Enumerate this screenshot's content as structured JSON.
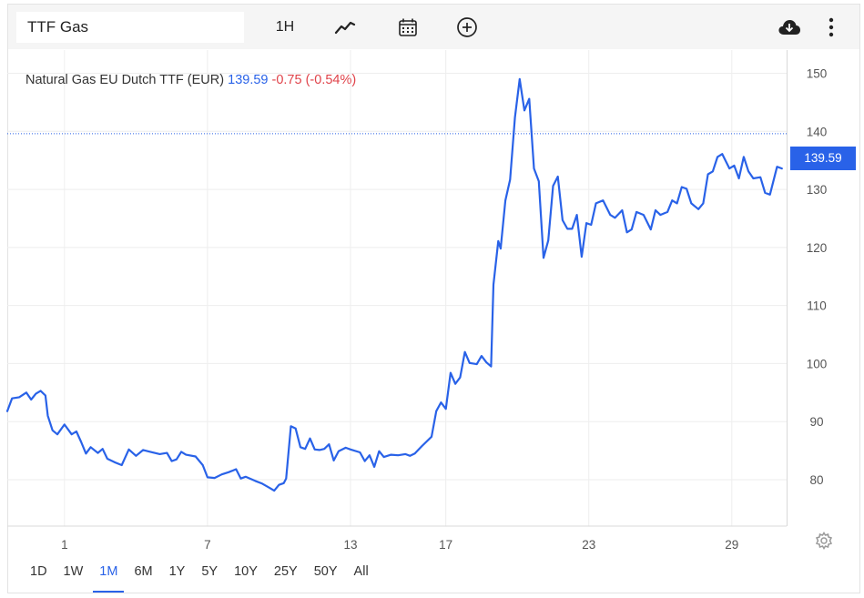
{
  "toolbar": {
    "search_value": "TTF Gas",
    "interval_label": "1H",
    "icons": [
      "line-chart-icon",
      "calendar-icon",
      "plus-circle-icon",
      "cloud-download-icon",
      "more-vert-icon"
    ]
  },
  "legend": {
    "name": "Natural Gas EU Dutch TTF (EUR)",
    "price": "139.59",
    "change": "-0.75 (-0.54%)"
  },
  "price_tag": "139.59",
  "ranges": [
    {
      "label": "1D",
      "active": false
    },
    {
      "label": "1W",
      "active": false
    },
    {
      "label": "1M",
      "active": true
    },
    {
      "label": "6M",
      "active": false
    },
    {
      "label": "1Y",
      "active": false
    },
    {
      "label": "5Y",
      "active": false
    },
    {
      "label": "10Y",
      "active": false
    },
    {
      "label": "25Y",
      "active": false
    },
    {
      "label": "50Y",
      "active": false
    },
    {
      "label": "All",
      "active": false
    }
  ],
  "colors": {
    "line": "#2962e8",
    "positive": "#2962e8",
    "negative": "#e0434a",
    "grid": "#eeeeee"
  },
  "chart_data": {
    "type": "line",
    "title": "Natural Gas EU Dutch TTF (EUR)",
    "xlabel": "",
    "ylabel": "",
    "ylim": [
      72,
      154
    ],
    "xlim": [
      -1.4,
      31.3
    ],
    "y_ticks": [
      80,
      90,
      100,
      110,
      120,
      130,
      140,
      150
    ],
    "x_ticks": [
      {
        "value": 1,
        "label": "1"
      },
      {
        "value": 7,
        "label": "7"
      },
      {
        "value": 13,
        "label": "13"
      },
      {
        "value": 17,
        "label": "17"
      },
      {
        "value": 23,
        "label": "23"
      },
      {
        "value": 29,
        "label": "29"
      }
    ],
    "grid": true,
    "last_value": 139.59,
    "series": [
      {
        "values": [
          [
            -1.4,
            91.8
          ],
          [
            -1.2,
            94
          ],
          [
            -0.9,
            94.2
          ],
          [
            -0.6,
            95
          ],
          [
            -0.4,
            93.8
          ],
          [
            -0.2,
            94.8
          ],
          [
            0.0,
            95.3
          ],
          [
            0.2,
            94.5
          ],
          [
            0.3,
            91
          ],
          [
            0.5,
            88.5
          ],
          [
            0.7,
            87.8
          ],
          [
            1.0,
            89.5
          ],
          [
            1.3,
            87.8
          ],
          [
            1.5,
            88.3
          ],
          [
            1.7,
            86.5
          ],
          [
            1.9,
            84.5
          ],
          [
            2.1,
            85.6
          ],
          [
            2.4,
            84.6
          ],
          [
            2.6,
            85.3
          ],
          [
            2.8,
            83.6
          ],
          [
            3.1,
            83
          ],
          [
            3.4,
            82.5
          ],
          [
            3.7,
            85.2
          ],
          [
            4.0,
            84.1
          ],
          [
            4.3,
            85.1
          ],
          [
            4.6,
            84.8
          ],
          [
            5.0,
            84.4
          ],
          [
            5.3,
            84.6
          ],
          [
            5.5,
            83.2
          ],
          [
            5.7,
            83.5
          ],
          [
            5.9,
            84.8
          ],
          [
            6.1,
            84.3
          ],
          [
            6.5,
            84
          ],
          [
            6.8,
            82.5
          ],
          [
            7.0,
            80.4
          ],
          [
            7.3,
            80.3
          ],
          [
            7.6,
            80.9
          ],
          [
            7.9,
            81.3
          ],
          [
            8.2,
            81.8
          ],
          [
            8.4,
            80.2
          ],
          [
            8.6,
            80.5
          ],
          [
            9.0,
            79.8
          ],
          [
            9.3,
            79.3
          ],
          [
            9.6,
            78.6
          ],
          [
            9.8,
            78.1
          ],
          [
            10.0,
            79.1
          ],
          [
            10.2,
            79.4
          ],
          [
            10.3,
            80.2
          ],
          [
            10.5,
            89.2
          ],
          [
            10.7,
            88.8
          ],
          [
            10.9,
            85.6
          ],
          [
            11.1,
            85.3
          ],
          [
            11.3,
            87.1
          ],
          [
            11.5,
            85.2
          ],
          [
            11.7,
            85.1
          ],
          [
            11.9,
            85.3
          ],
          [
            12.1,
            86.1
          ],
          [
            12.3,
            83.3
          ],
          [
            12.5,
            84.9
          ],
          [
            12.8,
            85.5
          ],
          [
            13.0,
            85.2
          ],
          [
            13.4,
            84.7
          ],
          [
            13.6,
            83.2
          ],
          [
            13.8,
            84.2
          ],
          [
            14.0,
            82.2
          ],
          [
            14.2,
            84.9
          ],
          [
            14.4,
            83.9
          ],
          [
            14.7,
            84.3
          ],
          [
            15.0,
            84.2
          ],
          [
            15.3,
            84.4
          ],
          [
            15.5,
            84.1
          ],
          [
            15.7,
            84.5
          ],
          [
            16.0,
            85.8
          ],
          [
            16.4,
            87.4
          ],
          [
            16.6,
            91.8
          ],
          [
            16.8,
            93.3
          ],
          [
            17.0,
            92.2
          ],
          [
            17.2,
            98.4
          ],
          [
            17.4,
            96.5
          ],
          [
            17.6,
            97.6
          ],
          [
            17.8,
            102
          ],
          [
            18.0,
            100.1
          ],
          [
            18.3,
            99.9
          ],
          [
            18.5,
            101.3
          ],
          [
            18.7,
            100.2
          ],
          [
            18.9,
            99.5
          ],
          [
            19.0,
            113.6
          ],
          [
            19.2,
            121.1
          ],
          [
            19.3,
            119.8
          ],
          [
            19.5,
            128.1
          ],
          [
            19.7,
            131.7
          ],
          [
            19.9,
            142.4
          ],
          [
            20.1,
            149
          ],
          [
            20.3,
            143.6
          ],
          [
            20.5,
            145.6
          ],
          [
            20.7,
            133.6
          ],
          [
            20.9,
            131.4
          ],
          [
            21.1,
            118.2
          ],
          [
            21.3,
            121.2
          ],
          [
            21.5,
            130.6
          ],
          [
            21.7,
            132.2
          ],
          [
            21.9,
            124.7
          ],
          [
            22.1,
            123.2
          ],
          [
            22.3,
            123.2
          ],
          [
            22.5,
            125.6
          ],
          [
            22.7,
            118.4
          ],
          [
            22.9,
            124.2
          ],
          [
            23.1,
            123.9
          ],
          [
            23.3,
            127.6
          ],
          [
            23.6,
            128.1
          ],
          [
            23.9,
            125.6
          ],
          [
            24.1,
            125.1
          ],
          [
            24.4,
            126.4
          ],
          [
            24.6,
            122.6
          ],
          [
            24.8,
            123.1
          ],
          [
            25.0,
            126.1
          ],
          [
            25.3,
            125.6
          ],
          [
            25.6,
            123.1
          ],
          [
            25.8,
            126.4
          ],
          [
            26.0,
            125.6
          ],
          [
            26.3,
            126.1
          ],
          [
            26.5,
            128.1
          ],
          [
            26.7,
            127.6
          ],
          [
            26.9,
            130.4
          ],
          [
            27.1,
            130.1
          ],
          [
            27.3,
            127.6
          ],
          [
            27.6,
            126.6
          ],
          [
            27.8,
            127.6
          ],
          [
            28.0,
            132.6
          ],
          [
            28.2,
            133.1
          ],
          [
            28.4,
            135.6
          ],
          [
            28.6,
            136.1
          ],
          [
            28.9,
            133.6
          ],
          [
            29.1,
            134.1
          ],
          [
            29.3,
            131.9
          ],
          [
            29.5,
            135.6
          ],
          [
            29.7,
            133.1
          ],
          [
            29.9,
            131.9
          ],
          [
            30.2,
            132.1
          ],
          [
            30.4,
            129.4
          ],
          [
            30.6,
            129.1
          ],
          [
            30.9,
            133.9
          ],
          [
            31.1,
            133.6
          ]
        ]
      }
    ]
  }
}
